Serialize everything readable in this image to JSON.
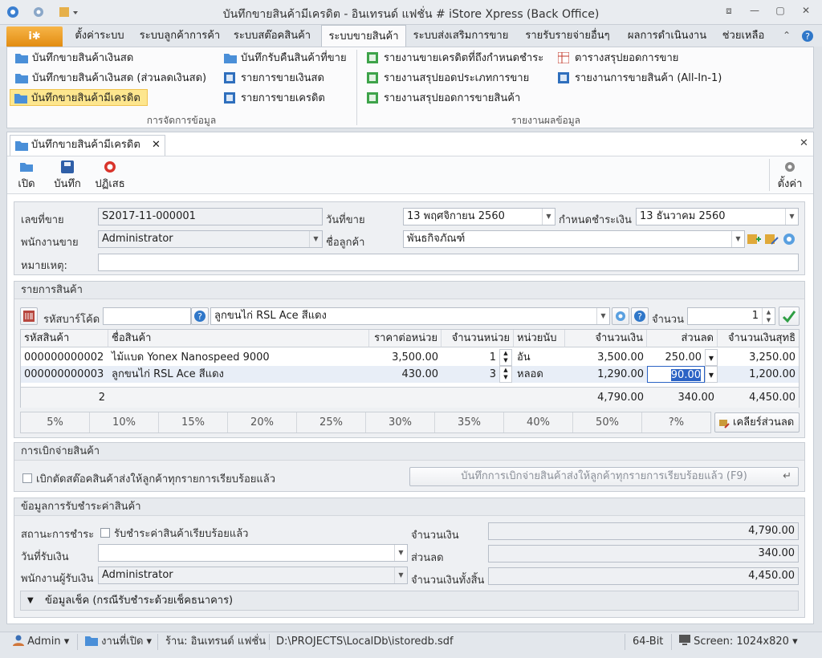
{
  "window": {
    "title": "บันทึกขายสินค้ามีเครดิต - อินเทรนด์ แฟชั่น # iStore Xpress (Back Office)"
  },
  "menu_tabs": [
    "ตั้งค่าระบบ",
    "ระบบลูกค้าการค้า",
    "ระบบสต๊อคสินค้า",
    "ระบบขายสินค้า",
    "ระบบส่งเสริมการขาย",
    "รายรับรายจ่ายอื่นๆ",
    "ผลการดำเนินงาน",
    "ช่วยเหลือ"
  ],
  "ribbon": {
    "group1": {
      "caption": "การจัดการข้อมูล",
      "col1": [
        "บันทึกขายสินค้าเงินสด",
        "บันทึกขายสินค้าเงินสด (ส่วนลดเงินสด)",
        "บันทึกขายสินค้ามีเครดิต"
      ],
      "col2": [
        "บันทึกรับคืนสินค้าที่ขาย",
        "รายการขายเงินสด",
        "รายการขายเครดิต"
      ]
    },
    "group2": {
      "caption": "รายงานผลข้อมูล",
      "col1": [
        "รายงานขายเครดิตที่ถึงกำหนดชำระ",
        "รายงานสรุปยอดประเภทการขาย",
        "รายงานสรุปยอดการขายสินค้า"
      ],
      "col2": [
        "ตารางสรุปยอดการขาย",
        "รายงานการขายสินค้า (All-In-1)"
      ]
    }
  },
  "doc_tab": "บันทึกขายสินค้ามีเครดิต",
  "toolbar": {
    "open": "เปิด",
    "save": "บันทึก",
    "cancel": "ปฏิเสธ",
    "settings": "ตั้งค่า"
  },
  "form": {
    "sale_no_label": "เลขที่ขาย",
    "sale_no": "S2017-11-000001",
    "sale_date_label": "วันที่ขาย",
    "sale_date": "13 พฤศจิกายน 2560",
    "due_label": "กำหนดชำระเงิน",
    "due_date": "13 ธันวาคม 2560",
    "seller_label": "พนักงานขาย",
    "seller": "Administrator",
    "customer_label": "ชื่อลูกค้า",
    "customer": "พันธกิจภัณฑ์",
    "note_label": "หมายเหตุ:"
  },
  "items": {
    "section": "รายการสินค้า",
    "barcode_label": "รหัสบาร์โค้ด",
    "product_select": "ลูกขนไก่ RSL Ace สีแดง",
    "qty_label": "จำนวน",
    "qty": "1",
    "columns": [
      "รหัสสินค้า",
      "ชื่อสินค้า",
      "ราคาต่อหน่วย",
      "จำนวนหน่วย",
      "หน่วยนับ",
      "จำนวนเงิน",
      "ส่วนลด",
      "จำนวนเงินสุทธิ"
    ],
    "rows": [
      [
        "000000000002",
        "ไม้แบด Yonex Nanospeed 9000",
        "3,500.00",
        "1",
        "อัน",
        "3,500.00",
        "250.00",
        "3,250.00"
      ],
      [
        "000000000003",
        "ลูกขนไก่ RSL Ace สีแดง",
        "430.00",
        "3",
        "หลอด",
        "1,290.00",
        "90.00",
        "1,200.00"
      ]
    ],
    "footer": {
      "count": "2",
      "amount": "4,790.00",
      "discount": "340.00",
      "net": "4,450.00"
    },
    "pct_buttons": [
      "5%",
      "10%",
      "15%",
      "20%",
      "25%",
      "30%",
      "35%",
      "40%",
      "50%",
      "?%"
    ],
    "clear_discount": "เคลียร์ส่วนลด"
  },
  "dispatch": {
    "section": "การเบิกจ่ายสินค้า",
    "checkbox": "เบิกตัดสต๊อคสินค้าส่งให้ลูกค้าทุกรายการเรียบร้อยแล้ว",
    "button": "บันทึกการเบิกจ่ายสินค้าส่งให้ลูกค้าทุกรายการเรียบร้อยแล้ว (F9)"
  },
  "payment": {
    "section": "ข้อมูลการรับชำระค่าสินค้า",
    "status_label": "สถานะการชำระ",
    "status_check": "รับชำระค่าสินค้าเรียบร้อยแล้ว",
    "date_label": "วันที่รับเงิน",
    "receiver_label": "พนักงานผู้รับเงิน",
    "receiver": "Administrator",
    "amount_label": "จำนวนเงิน",
    "amount": "4,790.00",
    "discount_label": "ส่วนลด",
    "discount": "340.00",
    "total_label": "จำนวนเงินทั้งสิ้น",
    "total": "4,450.00",
    "cheque": "ข้อมูลเช็ค (กรณีรับชำระด้วยเช็คธนาคาร)"
  },
  "status": {
    "user": "Admin",
    "open_jobs": "งานที่เปิด",
    "store": "ร้าน: อินเทรนด์ แฟชั่น",
    "db_path": "D:\\PROJECTS\\LocalDb\\istoredb.sdf",
    "bits": "64-Bit",
    "screen": "Screen: 1024x820"
  },
  "colors": {
    "accent_orange": "#e8961a",
    "highlight": "#fde68e",
    "selected_cell": "#2b63c5"
  }
}
